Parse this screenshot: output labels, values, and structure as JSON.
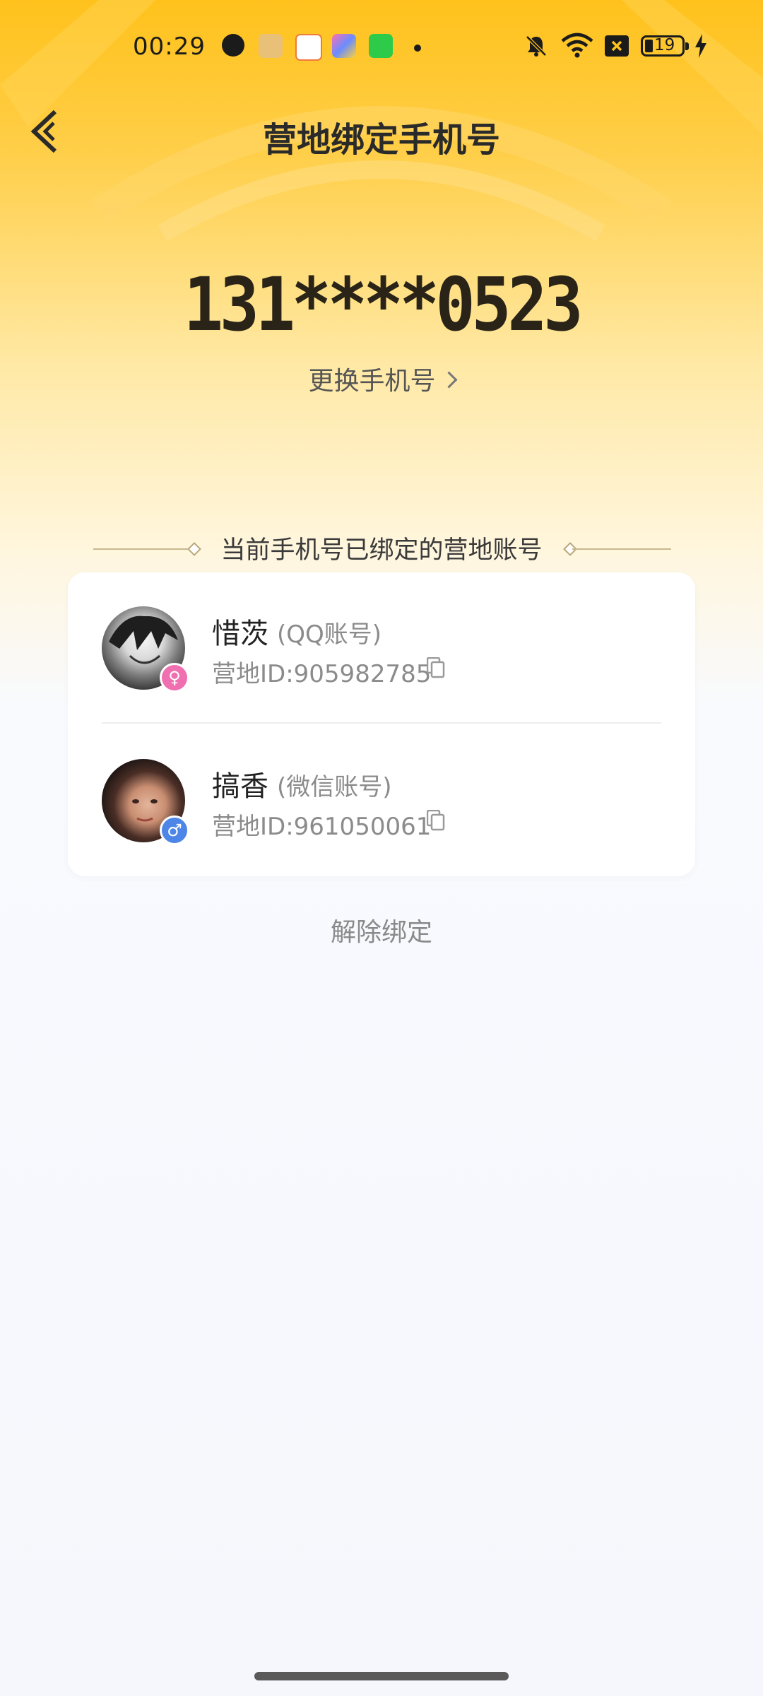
{
  "status_bar": {
    "time": "00:29",
    "battery_level": "19",
    "icons": [
      "notification-app-icon",
      "game-app-icon",
      "video-app-icon",
      "star-app-icon",
      "store-app-icon",
      "dot-icon",
      "mute-bell-icon",
      "wifi-icon",
      "sim-off-icon",
      "battery-icon",
      "charging-icon"
    ]
  },
  "header": {
    "title": "营地绑定手机号",
    "back_icon": "chevron-left-icon"
  },
  "phone": {
    "number": "131****0523",
    "change_label": "更换手机号"
  },
  "section": {
    "title": "当前手机号已绑定的营地账号"
  },
  "accounts": [
    {
      "name": "惜茨",
      "type": "(QQ账号)",
      "id": "营地ID:905982785",
      "gender": "female",
      "gender_symbol": "♀",
      "gender_color": "#f06fb0"
    },
    {
      "name": "搞香",
      "type": "(微信账号)",
      "id": "营地ID:961050061",
      "gender": "male",
      "gender_symbol": "♂",
      "gender_color": "#4e86e8"
    }
  ],
  "actions": {
    "unbind_label": "解除绑定"
  },
  "colors": {
    "accent_yellow": "#ffc21c",
    "page_bg": "#f5f7fc"
  }
}
